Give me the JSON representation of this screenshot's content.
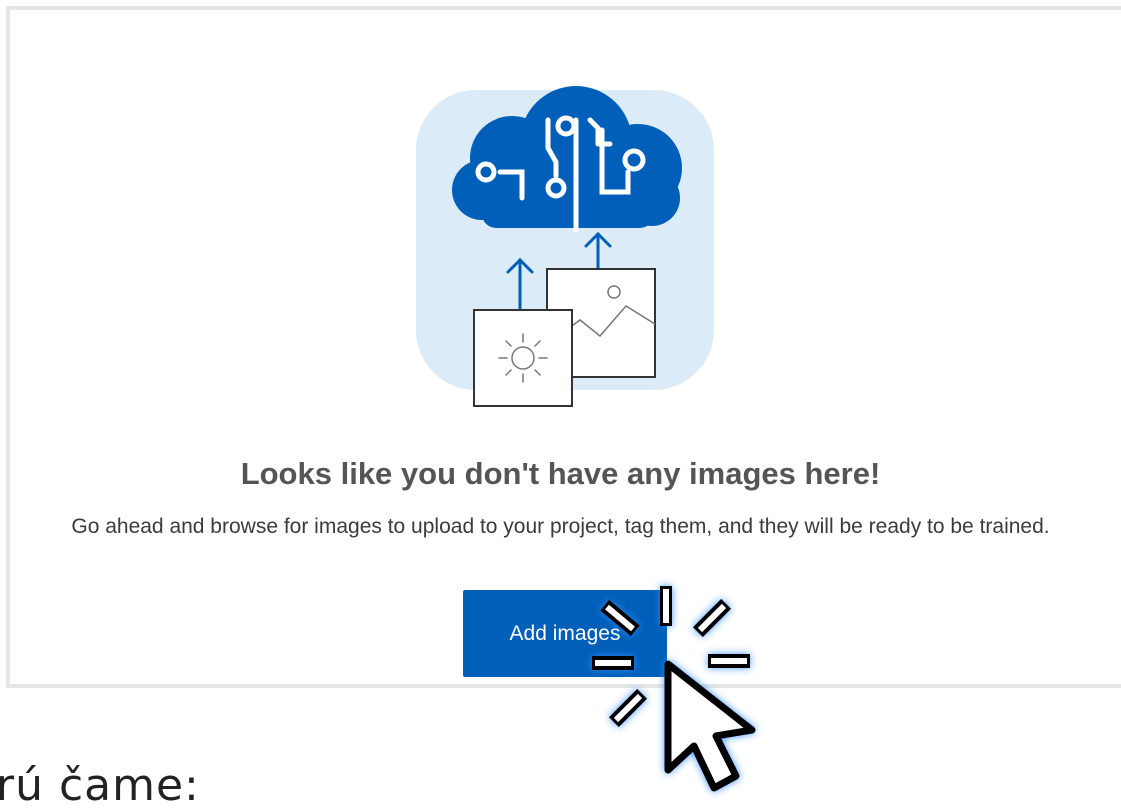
{
  "empty_state": {
    "heading": "Looks like you don't have any images here!",
    "description": "Go ahead and browse for images to upload to your project, tag them, and they will be ready to be trained.",
    "add_button_label": "Add images"
  },
  "illustration": {
    "icon": "cloud-ai-upload-icon",
    "accent_color": "#005fb8",
    "background_color": "#dcebf8"
  },
  "cursor": {
    "icon": "mouse-pointer-click-icon"
  },
  "caption_fragment": "rú čame:"
}
